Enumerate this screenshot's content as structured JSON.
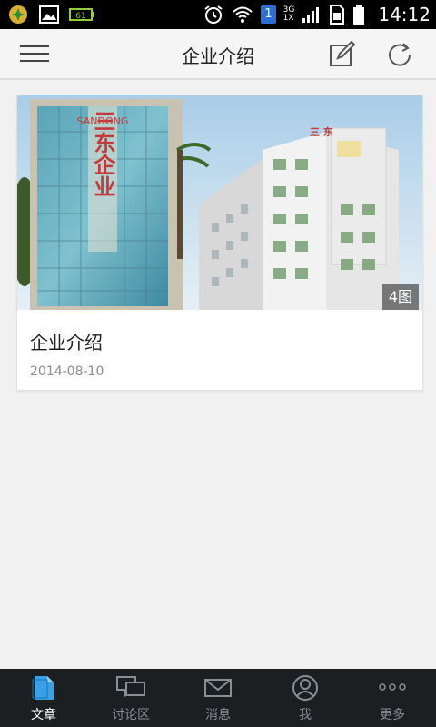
{
  "status_bar": {
    "sim_badge": "1",
    "network_top": "3G",
    "network_bottom": "1X",
    "battery_label": "61",
    "time": "14:12"
  },
  "app_bar": {
    "title": "企业介绍"
  },
  "article_card": {
    "title": "企业介绍",
    "date": "2014-08-10",
    "image_count": "4图",
    "building_sign": "三东企业",
    "building_sign_right": "三 东",
    "logo_text": "SANDONG"
  },
  "tab_bar": {
    "tabs": [
      {
        "label": "文章",
        "icon": "document-icon",
        "active": true
      },
      {
        "label": "讨论区",
        "icon": "chat-bubbles-icon",
        "active": false
      },
      {
        "label": "消息",
        "icon": "envelope-icon",
        "active": false
      },
      {
        "label": "我",
        "icon": "user-icon",
        "active": false
      },
      {
        "label": "更多",
        "icon": "more-dots-icon",
        "active": false
      }
    ]
  },
  "colors": {
    "tab_active": "#3aa0e6",
    "tab_bar_bg": "#1c1f22",
    "app_bg": "#f1f1f1"
  }
}
